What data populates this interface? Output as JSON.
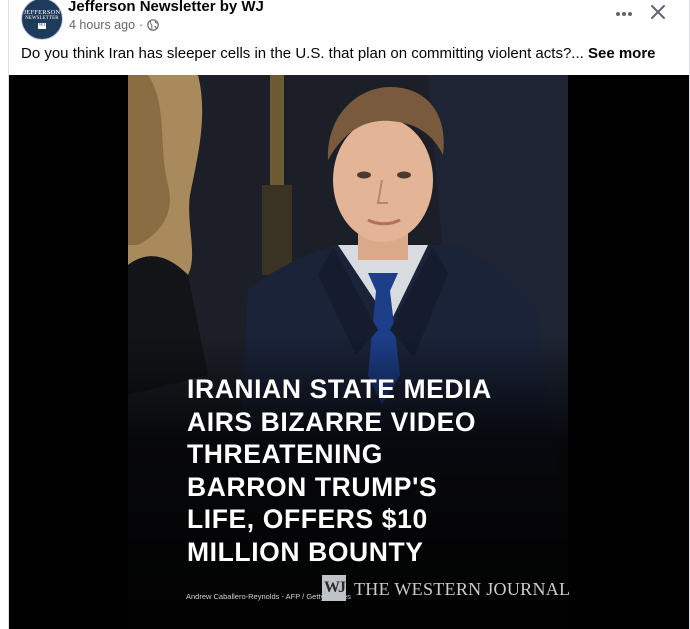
{
  "post": {
    "page_name": "Jefferson Newsletter by WJ",
    "timestamp": "4 hours ago",
    "separator": "·",
    "privacy_icon": "globe-icon",
    "caption": "Do you think Iran has sleeper cells in the U.S. that plan on committing violent acts?...",
    "see_more_label": "See more",
    "more_icon": "more-options-icon",
    "close_icon": "close-icon"
  },
  "avatar": {
    "line1": "JEFFERSON",
    "line2": "NEWSLETTER",
    "line3": "WJ"
  },
  "media": {
    "headline_lines": [
      "IRANIAN STATE MEDIA",
      "AIRS BIZARRE VIDEO",
      "THREATENING",
      "BARRON TRUMP'S",
      "LIFE, OFFERS $10",
      "MILLION BOUNTY"
    ],
    "photo_credit": "Andrew Caballero-Reynolds - AFP / Getty Images",
    "logo_mark": "WJ",
    "publisher": "THE WESTERN JOURNAL"
  },
  "colors": {
    "text_primary": "#050505",
    "text_secondary": "#65676b",
    "media_background": "#000000",
    "headline_text": "#ffffff"
  }
}
